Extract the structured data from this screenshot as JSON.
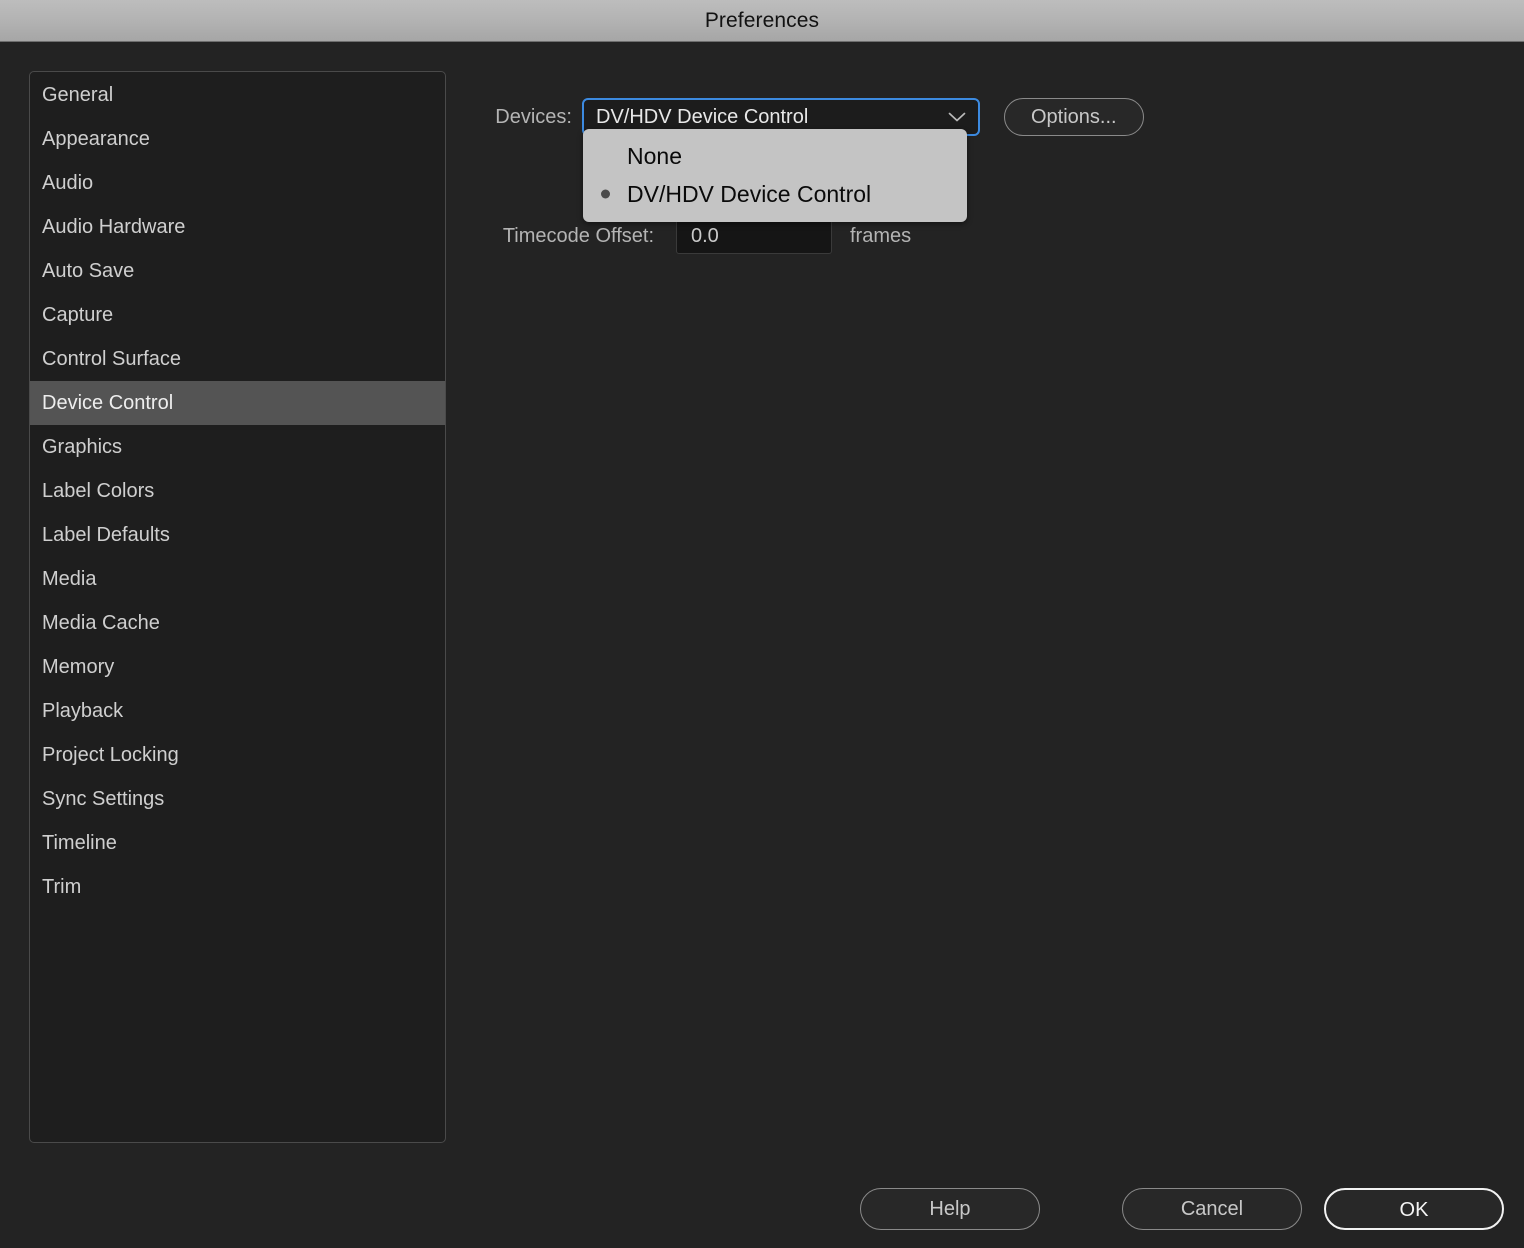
{
  "window": {
    "title": "Preferences"
  },
  "sidebar": {
    "items": [
      {
        "label": "General",
        "selected": false
      },
      {
        "label": "Appearance",
        "selected": false
      },
      {
        "label": "Audio",
        "selected": false
      },
      {
        "label": "Audio Hardware",
        "selected": false
      },
      {
        "label": "Auto Save",
        "selected": false
      },
      {
        "label": "Capture",
        "selected": false
      },
      {
        "label": "Control Surface",
        "selected": false
      },
      {
        "label": "Device Control",
        "selected": true
      },
      {
        "label": "Graphics",
        "selected": false
      },
      {
        "label": "Label Colors",
        "selected": false
      },
      {
        "label": "Label Defaults",
        "selected": false
      },
      {
        "label": "Media",
        "selected": false
      },
      {
        "label": "Media Cache",
        "selected": false
      },
      {
        "label": "Memory",
        "selected": false
      },
      {
        "label": "Playback",
        "selected": false
      },
      {
        "label": "Project Locking",
        "selected": false
      },
      {
        "label": "Sync Settings",
        "selected": false
      },
      {
        "label": "Timeline",
        "selected": false
      },
      {
        "label": "Trim",
        "selected": false
      }
    ]
  },
  "main": {
    "devices": {
      "label": "Devices:",
      "selected_value": "DV/HDV Device Control",
      "chevron_icon": "chevron-down-icon",
      "options_button": "Options...",
      "menu_open": true,
      "options": [
        {
          "label": "None",
          "checked": false
        },
        {
          "label": "DV/HDV Device Control",
          "checked": true
        }
      ]
    },
    "timecode": {
      "label": "Timecode Offset:",
      "value": "0.0",
      "placeholder": "0.0",
      "unit": "frames"
    }
  },
  "footer": {
    "help_label": "Help",
    "cancel_label": "Cancel",
    "ok_label": "OK"
  },
  "colors": {
    "window_background": "#232323",
    "titlebar_top": "#bdbdbd",
    "titlebar_bottom": "#a6a6a6",
    "sidebar_background": "#1e1e1e",
    "sidebar_selected": "#545454",
    "focus_ring": "#3c8ae0",
    "popup_background": "#c4c4c4",
    "text_primary": "#cfcfcf",
    "text_on_popup": "#0a0a0a"
  }
}
